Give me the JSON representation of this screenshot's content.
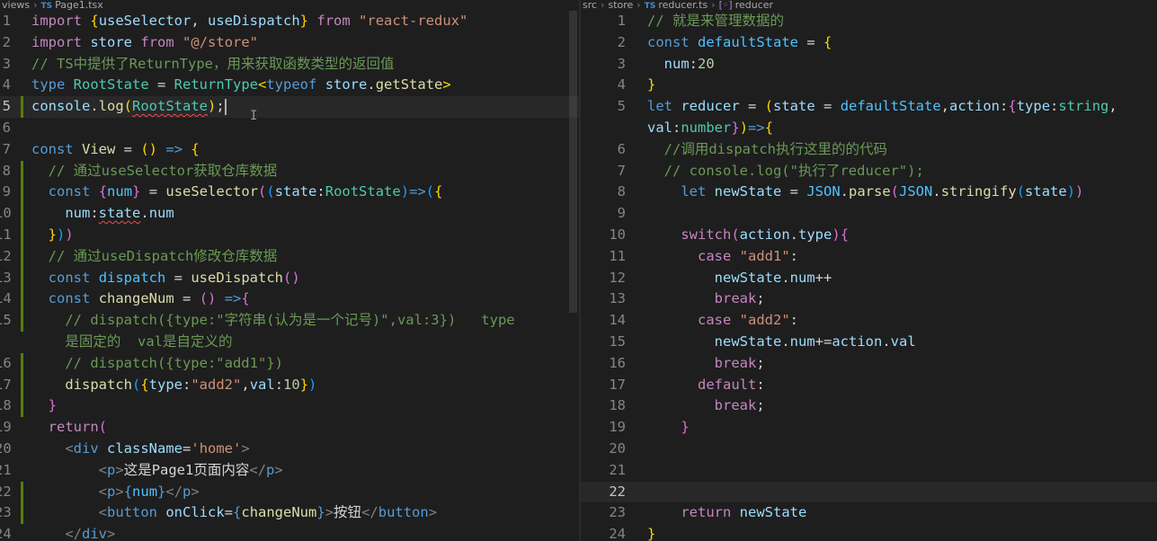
{
  "left_pane": {
    "breadcrumb": [
      "views",
      "Page1.tsx"
    ],
    "lines": [
      {
        "n": "1",
        "text": "import {useSelector, useDispatch} from \"react-redux\""
      },
      {
        "n": "2",
        "text": "import store from \"@/store\""
      },
      {
        "n": "3",
        "text": "// TS中提供了ReturnType，用来获取函数类型的返回值"
      },
      {
        "n": "4",
        "text": "type RootState = ReturnType<typeof store.getState>"
      },
      {
        "n": "5",
        "text": "console.log(RootState);"
      },
      {
        "n": "6",
        "text": ""
      },
      {
        "n": "7",
        "text": "const View = () => {"
      },
      {
        "n": "8",
        "text": "  // 通过useSelector获取仓库数据"
      },
      {
        "n": "9",
        "text": "  const {num} = useSelector((state:RootState)=>({"
      },
      {
        "n": "10",
        "text": "    num:state.num"
      },
      {
        "n": "11",
        "text": "  }))"
      },
      {
        "n": "12",
        "text": "  // 通过useDispatch修改仓库数据"
      },
      {
        "n": "13",
        "text": "  const dispatch = useDispatch()"
      },
      {
        "n": "14",
        "text": "  const changeNum = () =>{"
      },
      {
        "n": "15",
        "text": "    // dispatch({type:\"字符串(认为是一个记号)\",val:3})   type"
      },
      {
        "n": "",
        "text": "    是固定的  val是自定义的"
      },
      {
        "n": "16",
        "text": "    // dispatch({type:\"add1\"})"
      },
      {
        "n": "17",
        "text": "    dispatch({type:\"add2\",val:10})"
      },
      {
        "n": "18",
        "text": "  }"
      },
      {
        "n": "19",
        "text": "  return("
      },
      {
        "n": "20",
        "text": "    <div className='home'>"
      },
      {
        "n": "21",
        "text": "        <p>这是Page1页面内容</p>"
      },
      {
        "n": "22",
        "text": "        <p>{num}</p>"
      },
      {
        "n": "23",
        "text": "        <button onClick={changeNum}>按钮</button>"
      },
      {
        "n": "24",
        "text": "    </div>"
      }
    ]
  },
  "right_pane": {
    "breadcrumb": [
      "src",
      "store",
      "reducer.ts",
      "reducer"
    ],
    "lines": [
      {
        "n": "1",
        "text": "// 就是来管理数据的"
      },
      {
        "n": "2",
        "text": "const defaultState = {"
      },
      {
        "n": "3",
        "text": "  num:20"
      },
      {
        "n": "4",
        "text": "}"
      },
      {
        "n": "5",
        "text": "let reducer = (state = defaultState,action:{type:string,"
      },
      {
        "n": "",
        "text": "val:number})=>{"
      },
      {
        "n": "6",
        "text": "  //调用dispatch执行这里的的代码"
      },
      {
        "n": "7",
        "text": "  // console.log(\"执行了reducer\");"
      },
      {
        "n": "8",
        "text": "    let newState = JSON.parse(JSON.stringify(state))"
      },
      {
        "n": "9",
        "text": ""
      },
      {
        "n": "10",
        "text": "    switch(action.type){"
      },
      {
        "n": "11",
        "text": "      case \"add1\":"
      },
      {
        "n": "12",
        "text": "        newState.num++"
      },
      {
        "n": "13",
        "text": "        break;"
      },
      {
        "n": "14",
        "text": "      case \"add2\":"
      },
      {
        "n": "15",
        "text": "        newState.num+=action.val"
      },
      {
        "n": "16",
        "text": "        break;"
      },
      {
        "n": "17",
        "text": "      default:"
      },
      {
        "n": "18",
        "text": "        break;"
      },
      {
        "n": "19",
        "text": "    }"
      },
      {
        "n": "20",
        "text": ""
      },
      {
        "n": "21",
        "text": ""
      },
      {
        "n": "22",
        "text": ""
      },
      {
        "n": "23",
        "text": "    return newState"
      },
      {
        "n": "24",
        "text": "}"
      }
    ]
  },
  "colors": {
    "background": "#1e1e1e",
    "keyword": "#c586c0",
    "storage": "#569cd6",
    "variable": "#9cdcfe",
    "function": "#dcdcaa",
    "type": "#4ec9b0",
    "string": "#ce9178",
    "number": "#b5cea8",
    "comment": "#6a9955"
  },
  "icons": {
    "file_type": "typescript-icon",
    "symbol": "symbol-variable-icon",
    "breadcrumb_separator": "chevron-right-icon"
  }
}
